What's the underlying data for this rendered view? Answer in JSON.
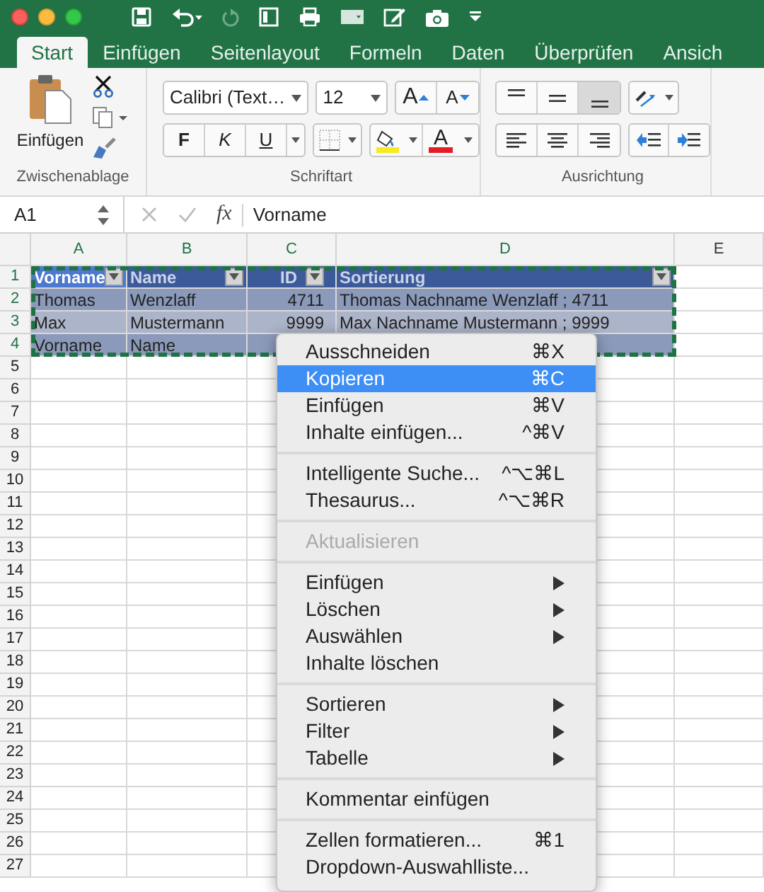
{
  "tabs": [
    {
      "label": "Start",
      "selected": true
    },
    {
      "label": "Einfügen",
      "selected": false
    },
    {
      "label": "Seitenlayout",
      "selected": false
    },
    {
      "label": "Formeln",
      "selected": false
    },
    {
      "label": "Daten",
      "selected": false
    },
    {
      "label": "Überprüfen",
      "selected": false
    },
    {
      "label": "Ansich",
      "selected": false
    }
  ],
  "ribbon": {
    "clipboard": {
      "paste_label": "Einfügen",
      "group_label": "Zwischenablage"
    },
    "font": {
      "font_name": "Calibri (Text…",
      "font_size": "12",
      "grow_label": "A",
      "shrink_label": "A",
      "bold": "F",
      "italic": "K",
      "underline": "U",
      "font_color_label": "A",
      "group_label": "Schriftart"
    },
    "alignment": {
      "group_label": "Ausrichtung"
    }
  },
  "formula_bar": {
    "name_box": "A1",
    "fx": "fx",
    "value": "Vorname"
  },
  "columns": [
    "A",
    "B",
    "C",
    "D",
    "E"
  ],
  "rows": [
    {
      "number": "1",
      "kind": "header",
      "cells": [
        "Vorname",
        "Name",
        "ID",
        "Sortierung"
      ]
    },
    {
      "number": "2",
      "kind": "band",
      "cells": [
        "Thomas",
        "Wenzlaff",
        "4711",
        "Thomas Nachname Wenzlaff ; 4711"
      ]
    },
    {
      "number": "3",
      "kind": "plain",
      "cells": [
        "Max",
        "Mustermann",
        "9999",
        "Max  Nachname Mustermann ; 9999"
      ]
    },
    {
      "number": "4",
      "kind": "band",
      "cells": [
        "Vorname",
        "Name",
        "",
        ""
      ]
    },
    {
      "number": "5",
      "kind": "empty",
      "cells": []
    },
    {
      "number": "6",
      "kind": "empty",
      "cells": []
    },
    {
      "number": "7",
      "kind": "empty",
      "cells": []
    },
    {
      "number": "8",
      "kind": "empty",
      "cells": []
    },
    {
      "number": "9",
      "kind": "empty",
      "cells": []
    },
    {
      "number": "10",
      "kind": "empty",
      "cells": []
    },
    {
      "number": "11",
      "kind": "empty",
      "cells": []
    },
    {
      "number": "12",
      "kind": "empty",
      "cells": []
    },
    {
      "number": "13",
      "kind": "empty",
      "cells": []
    },
    {
      "number": "14",
      "kind": "empty",
      "cells": []
    },
    {
      "number": "15",
      "kind": "empty",
      "cells": []
    },
    {
      "number": "16",
      "kind": "empty",
      "cells": []
    },
    {
      "number": "17",
      "kind": "empty",
      "cells": []
    },
    {
      "number": "18",
      "kind": "empty",
      "cells": []
    },
    {
      "number": "19",
      "kind": "empty",
      "cells": []
    },
    {
      "number": "20",
      "kind": "empty",
      "cells": []
    },
    {
      "number": "21",
      "kind": "empty",
      "cells": []
    },
    {
      "number": "22",
      "kind": "empty",
      "cells": []
    },
    {
      "number": "23",
      "kind": "empty",
      "cells": []
    },
    {
      "number": "24",
      "kind": "empty",
      "cells": []
    },
    {
      "number": "25",
      "kind": "empty",
      "cells": []
    },
    {
      "number": "26",
      "kind": "empty",
      "cells": []
    },
    {
      "number": "27",
      "kind": "empty",
      "cells": []
    }
  ],
  "context_menu": [
    {
      "kind": "item",
      "label": "Ausschneiden",
      "shortcut": "⌘X",
      "selected": false,
      "disabled": false,
      "submenu": false
    },
    {
      "kind": "item",
      "label": "Kopieren",
      "shortcut": "⌘C",
      "selected": true,
      "disabled": false,
      "submenu": false
    },
    {
      "kind": "item",
      "label": "Einfügen",
      "shortcut": "⌘V",
      "selected": false,
      "disabled": false,
      "submenu": false
    },
    {
      "kind": "item",
      "label": "Inhalte einfügen...",
      "shortcut": "^⌘V",
      "selected": false,
      "disabled": false,
      "submenu": false
    },
    {
      "kind": "separator"
    },
    {
      "kind": "item",
      "label": "Intelligente Suche...",
      "shortcut": "^⌥⌘L",
      "selected": false,
      "disabled": false,
      "submenu": false
    },
    {
      "kind": "item",
      "label": "Thesaurus...",
      "shortcut": "^⌥⌘R",
      "selected": false,
      "disabled": false,
      "submenu": false
    },
    {
      "kind": "separator"
    },
    {
      "kind": "item",
      "label": "Aktualisieren",
      "selected": false,
      "disabled": true,
      "submenu": false
    },
    {
      "kind": "separator"
    },
    {
      "kind": "item",
      "label": "Einfügen",
      "selected": false,
      "disabled": false,
      "submenu": true
    },
    {
      "kind": "item",
      "label": "Löschen",
      "selected": false,
      "disabled": false,
      "submenu": true
    },
    {
      "kind": "item",
      "label": "Auswählen",
      "selected": false,
      "disabled": false,
      "submenu": true
    },
    {
      "kind": "item",
      "label": "Inhalte löschen",
      "selected": false,
      "disabled": false,
      "submenu": false
    },
    {
      "kind": "separator"
    },
    {
      "kind": "item",
      "label": "Sortieren",
      "selected": false,
      "disabled": false,
      "submenu": true
    },
    {
      "kind": "item",
      "label": "Filter",
      "selected": false,
      "disabled": false,
      "submenu": true
    },
    {
      "kind": "item",
      "label": "Tabelle",
      "selected": false,
      "disabled": false,
      "submenu": true
    },
    {
      "kind": "separator"
    },
    {
      "kind": "item",
      "label": "Kommentar einfügen",
      "selected": false,
      "disabled": false,
      "submenu": false
    },
    {
      "kind": "separator"
    },
    {
      "kind": "item",
      "label": "Zellen formatieren...",
      "shortcut": "⌘1",
      "selected": false,
      "disabled": false,
      "submenu": false
    },
    {
      "kind": "item",
      "label": "Dropdown-Auswahlliste...",
      "selected": false,
      "disabled": false,
      "submenu": false
    }
  ]
}
